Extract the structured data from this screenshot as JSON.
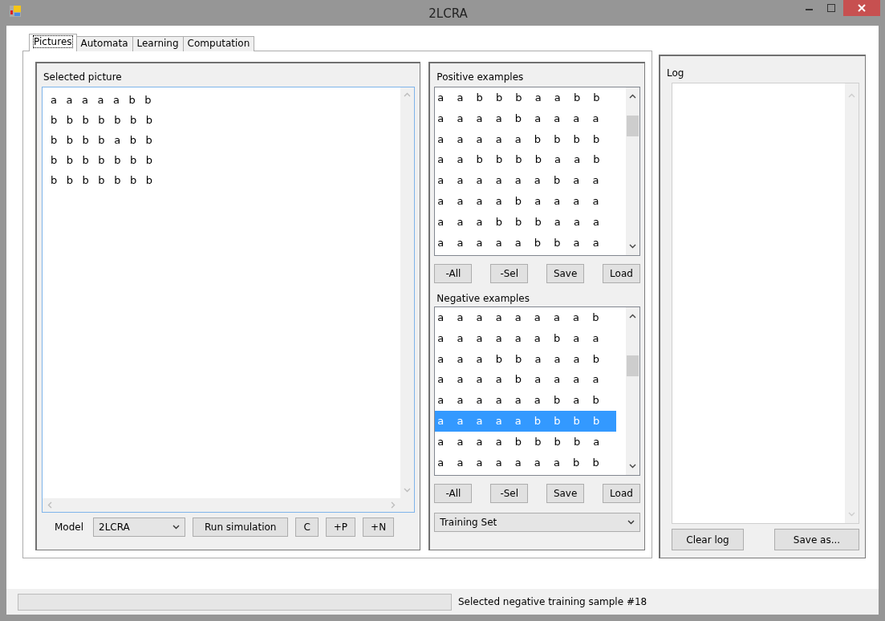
{
  "window": {
    "title": "2LCRA"
  },
  "tabs": [
    {
      "label": "Pictures",
      "selected": true
    },
    {
      "label": "Automata",
      "selected": false
    },
    {
      "label": "Learning",
      "selected": false
    },
    {
      "label": "Computation",
      "selected": false
    }
  ],
  "selected_picture": {
    "label": "Selected picture",
    "rows": [
      "a a a a a b b",
      "b b b b b b b",
      "b b b b a b b",
      "b b b b b b b",
      "b b b b b b b"
    ]
  },
  "model": {
    "label": "Model",
    "value": "2LCRA"
  },
  "picture_buttons": [
    "Run simulation",
    "C",
    "+P",
    "+N"
  ],
  "positive_examples": {
    "label": "Positive examples",
    "rows": [
      {
        "text": "a a b b b a a b b",
        "selected": false
      },
      {
        "text": "a a a a b a a a a",
        "selected": false
      },
      {
        "text": "a a a a a b b b b",
        "selected": false
      },
      {
        "text": "a a b b b b a a b",
        "selected": false
      },
      {
        "text": "a a a a a a b a a",
        "selected": false
      },
      {
        "text": "a a a a b a a a a",
        "selected": false
      },
      {
        "text": "a a a b b b a a a",
        "selected": false
      },
      {
        "text": "a a a a a b b a a",
        "selected": false
      }
    ],
    "buttons": [
      "-All",
      "-Sel",
      "Save",
      "Load"
    ]
  },
  "negative_examples": {
    "label": "Negative examples",
    "rows": [
      {
        "text": "a a a a a a a a b",
        "selected": false
      },
      {
        "text": "a a a a a a b a a",
        "selected": false
      },
      {
        "text": "a a a b b a a a b",
        "selected": false
      },
      {
        "text": "a a a a b a a a a",
        "selected": false
      },
      {
        "text": "a a a a a a b a b",
        "selected": false
      },
      {
        "text": "a a a a a b b b b",
        "selected": true
      },
      {
        "text": "a a a a b b b b a",
        "selected": false
      },
      {
        "text": "a a a a a a a b b",
        "selected": false
      }
    ],
    "buttons": [
      "-All",
      "-Sel",
      "Save",
      "Load"
    ]
  },
  "set_select": {
    "value": "Training Set"
  },
  "log": {
    "label": "Log",
    "buttons": [
      "Clear log",
      "Save as..."
    ]
  },
  "status_bar": {
    "text": "Selected negative training sample #18"
  }
}
